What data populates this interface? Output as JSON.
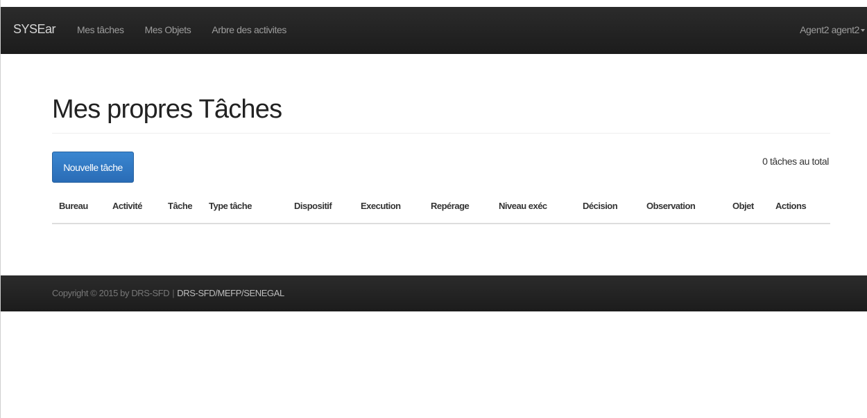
{
  "navbar": {
    "brand": "SYSEar",
    "links": [
      "Mes tâches",
      "Mes Objets",
      "Arbre des activites"
    ],
    "user": "Agent2 agent2"
  },
  "main": {
    "title": "Mes propres Tâches",
    "new_button": "Nouvelle tâche",
    "total": "0 tâches au total",
    "columns": [
      "Bureau",
      "Activité",
      "Tâche",
      "Type tâche",
      "Dispositif",
      "Execution",
      "Repérage",
      "Niveau exéc",
      "Décision",
      "Observation",
      "Objet",
      "Actions"
    ],
    "rows": []
  },
  "footer": {
    "copyright": "Copyright © 2015 by DRS-SFD",
    "separator": "|",
    "org": "DRS-SFD/MEFP/SENEGAL"
  },
  "colors": {
    "navbar_bg": "#222222",
    "primary_button": "#2f78c4",
    "nav_link": "#9d9d9d"
  }
}
